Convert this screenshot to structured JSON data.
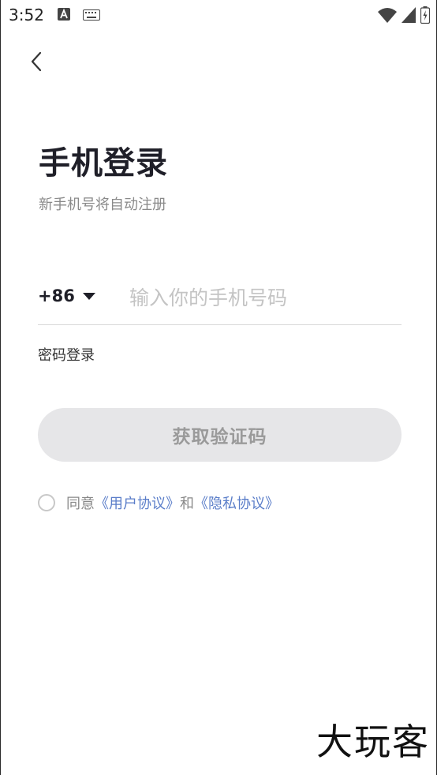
{
  "status_bar": {
    "time": "3:52",
    "icons": [
      "a-notification-icon",
      "keyboard-icon",
      "wifi-icon",
      "signal-icon",
      "battery-icon"
    ]
  },
  "header": {
    "back_icon": "chevron-left-icon"
  },
  "login": {
    "title": "手机登录",
    "subtitle": "新手机号将自动注册",
    "country_code": "+86",
    "phone_placeholder": "输入你的手机号码",
    "phone_value": "",
    "password_login_label": "密码登录",
    "get_code_label": "获取验证码"
  },
  "agreement": {
    "prefix": "同意",
    "user_agreement": "《用户协议》",
    "conjunction": "和",
    "privacy_policy": "《隐私协议》",
    "checked": false
  },
  "watermark": {
    "text": "大玩客"
  },
  "colors": {
    "title": "#1f1f28",
    "link": "#5b7ec9",
    "button_bg": "#e6e6e8",
    "button_text": "#9a9a9a"
  }
}
